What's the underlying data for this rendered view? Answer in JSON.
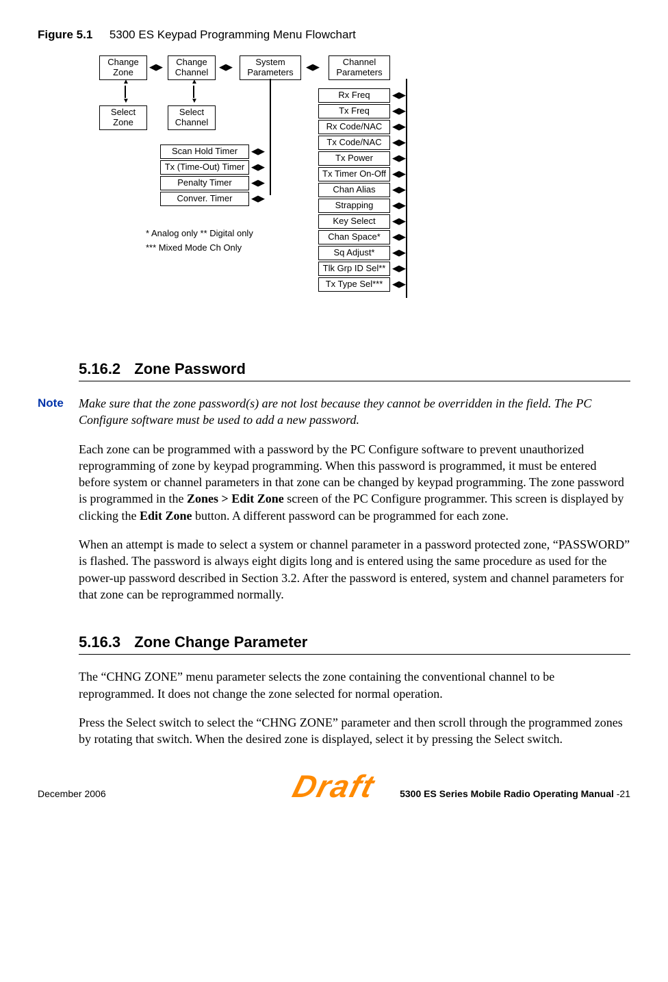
{
  "figure": {
    "number": "Figure 5.1",
    "title": "5300 ES Keypad Programming Menu Flowchart"
  },
  "flow": {
    "topRow": [
      "Change\nZone",
      "Change\nChannel",
      "System\nParameters",
      "Channel\nParameters"
    ],
    "secondRow": [
      "Select\nZone",
      "Select\nChannel"
    ],
    "sysParamsList": [
      "Scan Hold Timer",
      "Tx (Time-Out) Timer",
      "Penalty Timer",
      "Conver. Timer"
    ],
    "chanParamsList": [
      "Rx Freq",
      "Tx Freq",
      "Rx Code/NAC",
      "Tx Code/NAC",
      "Tx Power",
      "Tx Timer On-Off",
      "Chan Alias",
      "Strapping",
      "Key Select",
      "Chan Space*",
      "Sq Adjust*",
      "Tlk Grp ID Sel**",
      "Tx Type Sel***"
    ],
    "legendLine1": "* Analog only      ** Digital only",
    "legendLine2": "*** Mixed Mode Ch Only"
  },
  "sections": {
    "s1": {
      "num": "5.16.2",
      "title": "Zone Password"
    },
    "note": {
      "label": "Note",
      "text": "Make sure that the zone password(s) are not lost because they cannot be overridden in the field. The PC Configure software must be used to add a new password."
    },
    "p1a": "Each zone can be programmed with a password by the PC Configure software to prevent unauthorized reprogramming of zone by keypad programming. When this password is programmed, it must be entered before system or channel parameters in that zone can be changed by keypad programming. The zone password is programmed in the ",
    "p1bold1": "Zones > Edit Zone",
    "p1b": " screen of the PC Configure programmer. This screen is displayed by clicking the ",
    "p1bold2": "Edit Zone",
    "p1c": " button. A different password can be programmed for each zone.",
    "p2": "When an attempt is made to select a system or channel parameter in a password protected zone, “PASSWORD” is flashed. The password is always eight digits long and is entered using the same procedure as used for the power-up password described in Section 3.2. After the password is entered, system and channel parameters for that zone can be reprogrammed normally.",
    "s2": {
      "num": "5.16.3",
      "title": "Zone Change Parameter"
    },
    "p3": "The “CHNG ZONE” menu parameter selects the zone containing the conventional channel to be reprogrammed. It does not change the zone selected for normal operation.",
    "p4": "Press the Select switch to select the “CHNG ZONE” parameter and then scroll through the programmed zones by rotating that switch. When the desired zone is displayed, select it by pressing the Select switch."
  },
  "footer": {
    "left": "December 2006",
    "draft": "Draft",
    "rightBold": "5300 ES Series Mobile Radio Operating Manual",
    "rightTail": "    -21"
  }
}
